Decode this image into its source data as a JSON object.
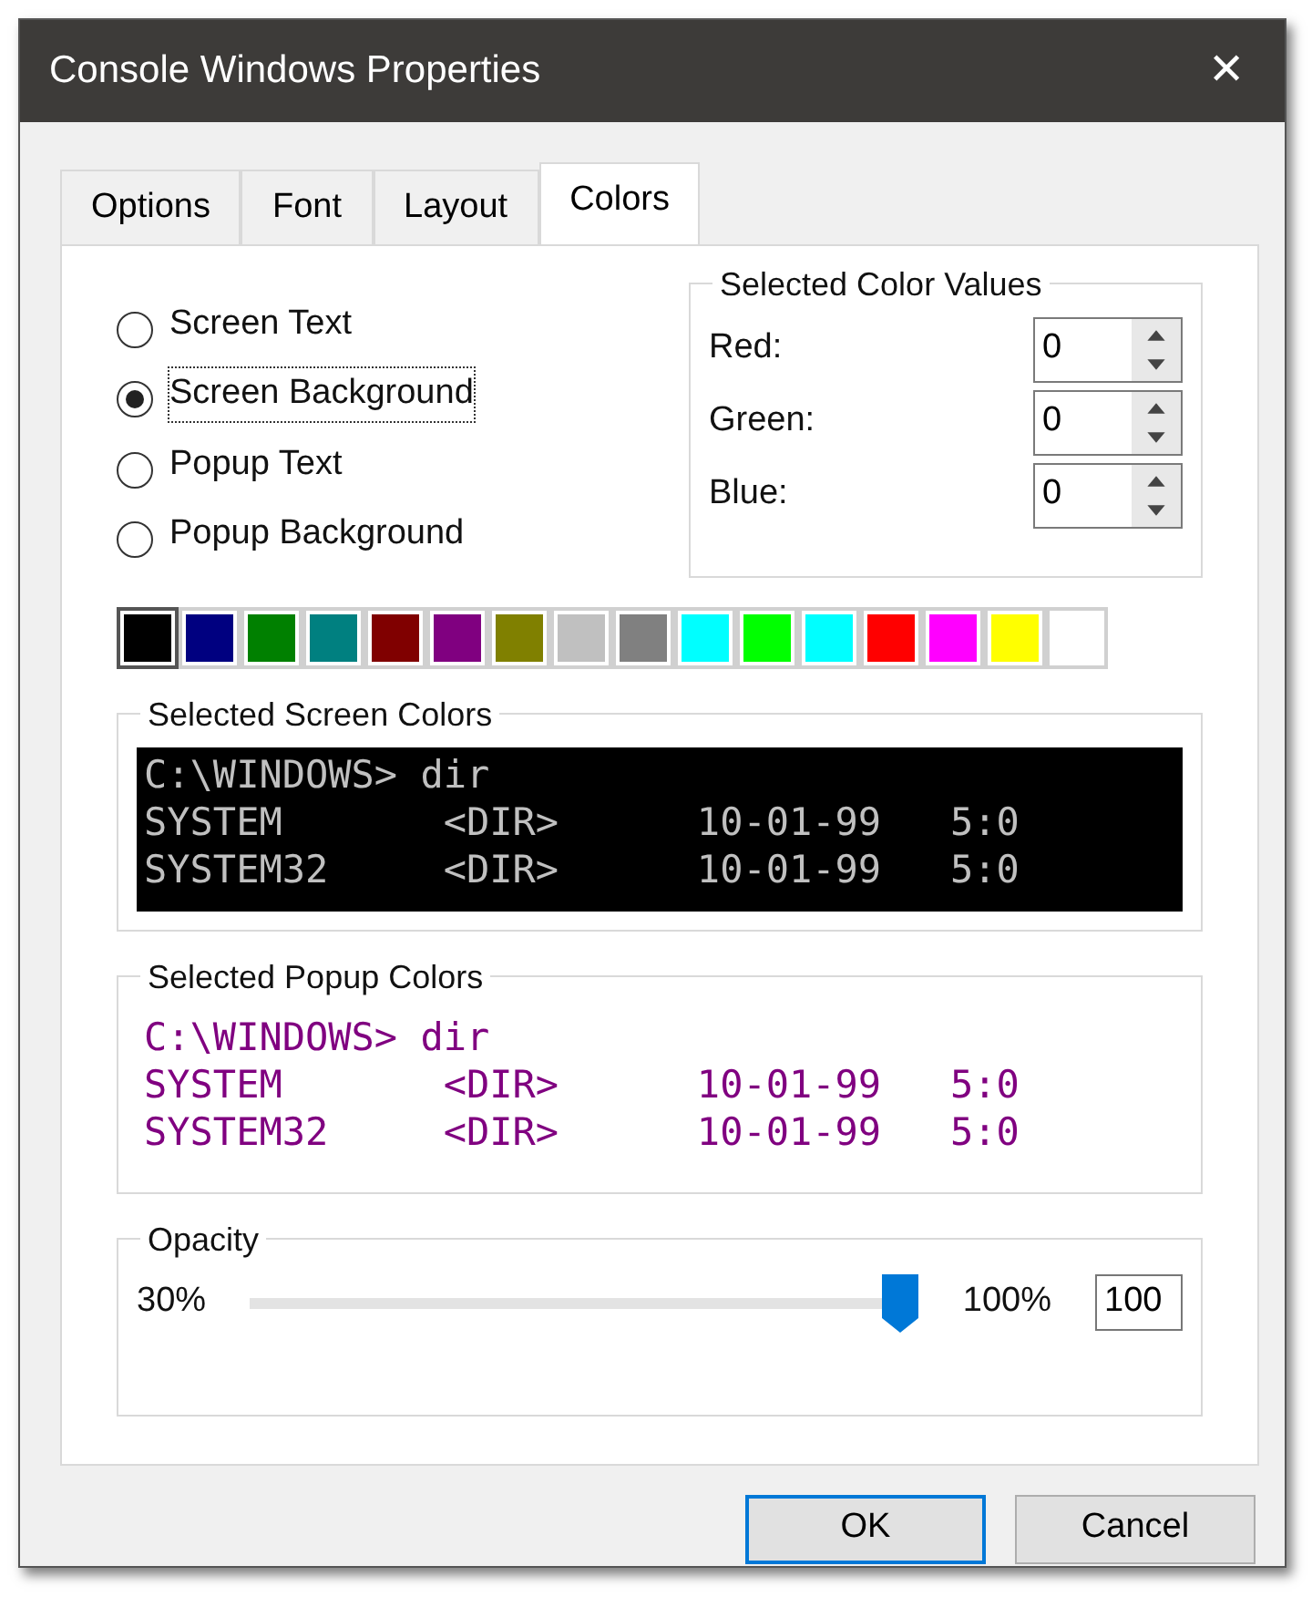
{
  "window": {
    "title": "Console Windows Properties",
    "close": "✕"
  },
  "tabs": [
    {
      "label": "Options",
      "selected": false
    },
    {
      "label": "Font",
      "selected": false
    },
    {
      "label": "Layout",
      "selected": false
    },
    {
      "label": "Colors",
      "selected": true
    }
  ],
  "targets": [
    {
      "label": "Screen Text",
      "selected": false
    },
    {
      "label": "Screen Background",
      "selected": true
    },
    {
      "label": "Popup Text",
      "selected": false
    },
    {
      "label": "Popup Background",
      "selected": false
    }
  ],
  "color_values": {
    "title": "Selected Color Values",
    "fields": [
      {
        "label": "Red:",
        "value": "0"
      },
      {
        "label": "Green:",
        "value": "0"
      },
      {
        "label": "Blue:",
        "value": "0"
      }
    ]
  },
  "palette": [
    {
      "color": "#000000",
      "selected": true
    },
    {
      "color": "#000080",
      "selected": false
    },
    {
      "color": "#008000",
      "selected": false
    },
    {
      "color": "#008080",
      "selected": false
    },
    {
      "color": "#800000",
      "selected": false
    },
    {
      "color": "#800080",
      "selected": false
    },
    {
      "color": "#808000",
      "selected": false
    },
    {
      "color": "#c0c0c0",
      "selected": false
    },
    {
      "color": "#808080",
      "selected": false
    },
    {
      "color": "#00ffff",
      "selected": false
    },
    {
      "color": "#00ff00",
      "selected": false
    },
    {
      "color": "#00ffff",
      "selected": false
    },
    {
      "color": "#ff0000",
      "selected": false
    },
    {
      "color": "#ff00ff",
      "selected": false
    },
    {
      "color": "#ffff00",
      "selected": false
    },
    {
      "color": "#ffffff",
      "selected": false
    }
  ],
  "previews": [
    {
      "title": "Selected Screen Colors",
      "kind": "screen",
      "lines": [
        "C:\\WINDOWS> dir",
        "SYSTEM       <DIR>      10-01-99   5:0",
        "SYSTEM32     <DIR>      10-01-99   5:0"
      ]
    },
    {
      "title": "Selected Popup Colors",
      "kind": "popup",
      "lines": [
        "C:\\WINDOWS> dir",
        "SYSTEM       <DIR>      10-01-99   5:0",
        "SYSTEM32     <DIR>      10-01-99   5:0"
      ]
    }
  ],
  "opacity": {
    "title": "Opacity",
    "min_label": "30%",
    "max_label": "100%",
    "level": 1,
    "value": "100"
  },
  "buttons": [
    {
      "label": "OK",
      "default": true
    },
    {
      "label": "Cancel",
      "default": false
    }
  ]
}
